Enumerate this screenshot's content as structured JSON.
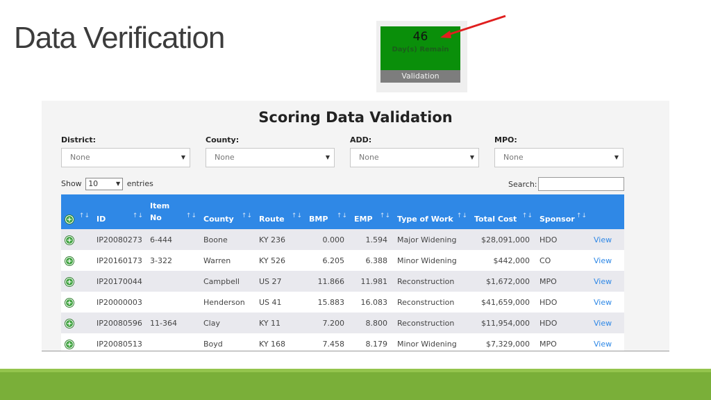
{
  "slide": {
    "title": "Data Verification"
  },
  "widget": {
    "count": "46",
    "subtitle": "Day(s) Remain",
    "bar_label": "Validation"
  },
  "panel": {
    "title": "Scoring Data Validation",
    "filters": [
      {
        "label": "District:",
        "value": "None"
      },
      {
        "label": "County:",
        "value": "None"
      },
      {
        "label": "ADD:",
        "value": "None"
      },
      {
        "label": "MPO:",
        "value": "None"
      }
    ],
    "show_label": "Show",
    "entries_value": "10",
    "entries_label": "entries",
    "search_label": "Search:",
    "search_value": ""
  },
  "table": {
    "headers": {
      "id": "ID",
      "item_no_1": "Item",
      "item_no_2": "No",
      "county": "County",
      "route": "Route",
      "bmp": "BMP",
      "emp": "EMP",
      "type": "Type of Work",
      "cost": "Total Cost",
      "sponsor": "Sponsor"
    },
    "rows": [
      {
        "id": "IP20080273",
        "item": "6-444",
        "county": "Boone",
        "route": "KY 236",
        "bmp": "0.000",
        "emp": "1.594",
        "type": "Major Widening",
        "cost": "$28,091,000",
        "sponsor": "HDO",
        "action": "View"
      },
      {
        "id": "IP20160173",
        "item": "3-322",
        "county": "Warren",
        "route": "KY 526",
        "bmp": "6.205",
        "emp": "6.388",
        "type": "Minor Widening",
        "cost": "$442,000",
        "sponsor": "CO",
        "action": "View"
      },
      {
        "id": "IP20170044",
        "item": "",
        "county": "Campbell",
        "route": "US 27",
        "bmp": "11.866",
        "emp": "11.981",
        "type": "Reconstruction",
        "cost": "$1,672,000",
        "sponsor": "MPO",
        "action": "View"
      },
      {
        "id": "IP20000003",
        "item": "",
        "county": "Henderson",
        "route": "US 41",
        "bmp": "15.883",
        "emp": "16.083",
        "type": "Reconstruction",
        "cost": "$41,659,000",
        "sponsor": "HDO",
        "action": "View"
      },
      {
        "id": "IP20080596",
        "item": "11-364",
        "county": "Clay",
        "route": "KY 11",
        "bmp": "7.200",
        "emp": "8.800",
        "type": "Reconstruction",
        "cost": "$11,954,000",
        "sponsor": "HDO",
        "action": "View"
      },
      {
        "id": "IP20080513",
        "item": "",
        "county": "Boyd",
        "route": "KY 168",
        "bmp": "7.458",
        "emp": "8.179",
        "type": "Minor Widening",
        "cost": "$7,329,000",
        "sponsor": "MPO",
        "action": "View"
      }
    ]
  },
  "colors": {
    "header_blue": "#2f88e6",
    "widget_green": "#0a8f0a",
    "footer_green": "#7aaf39",
    "arrow_red": "#e01f1f"
  }
}
